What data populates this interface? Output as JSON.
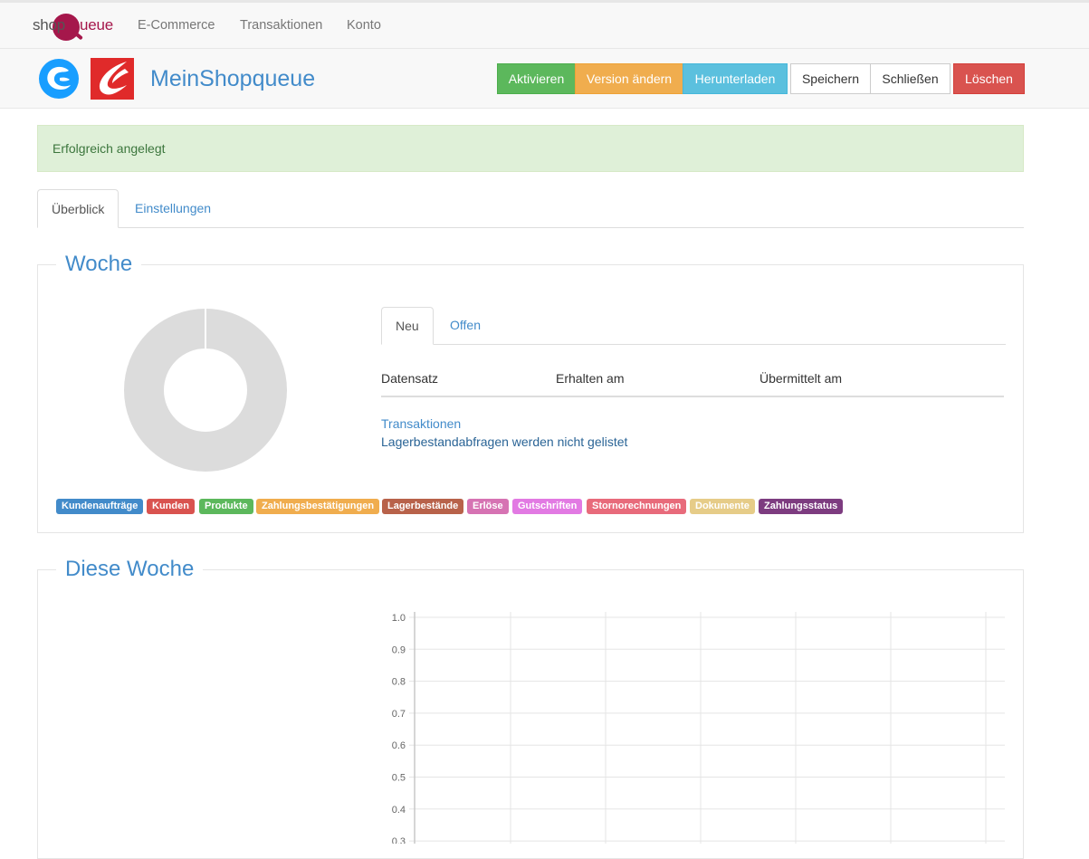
{
  "brand": {
    "prefix": "shop",
    "suffix": "ueue"
  },
  "topnav": {
    "items": [
      "E-Commerce",
      "Transaktionen",
      "Konto"
    ]
  },
  "header": {
    "title": "MeinShopqueue",
    "buttons": {
      "activate": "Aktivieren",
      "change_version": "Version ändern",
      "download": "Herunterladen",
      "save": "Speichern",
      "close": "Schließen",
      "delete": "Löschen"
    }
  },
  "alert": {
    "text": "Erfolgreich angelegt"
  },
  "tabs": {
    "overview": "Überblick",
    "settings": "Einstellungen"
  },
  "week_panel": {
    "title": "Woche",
    "subtabs": {
      "new": "Neu",
      "open": "Offen"
    },
    "table_headers": [
      "Datensatz",
      "Erhalten am",
      "Übermittelt am"
    ],
    "link_transactions": "Transaktionen",
    "note": "Lagerbestandabfragen werden nicht gelistet",
    "legend": [
      {
        "label": "Kundenaufträge",
        "color": "#428bca"
      },
      {
        "label": "Kunden",
        "color": "#d9534f"
      },
      {
        "label": "Produkte",
        "color": "#5cb85c"
      },
      {
        "label": "Zahlungsbestätigungen",
        "color": "#f0ad4e"
      },
      {
        "label": "Lagerbestände",
        "color": "#b8624a"
      },
      {
        "label": "Erlöse",
        "color": "#d673b3"
      },
      {
        "label": "Gutschriften",
        "color": "#e27ae3"
      },
      {
        "label": "Stornorechnungen",
        "color": "#e86b7b"
      },
      {
        "label": "Dokumente",
        "color": "#e6cc88"
      },
      {
        "label": "Zahlungsstatus",
        "color": "#7d3c80"
      }
    ]
  },
  "this_week_panel": {
    "title": "Diese Woche"
  },
  "chart_data": {
    "type": "line",
    "title": "",
    "xlabel": "",
    "ylabel": "",
    "y_ticks_visible": [
      "1.0",
      "0.9",
      "0.8",
      "0.7",
      "0.6",
      "0.5",
      "0.4",
      "0.3"
    ],
    "ylim": [
      0,
      1.0
    ],
    "grid": true,
    "series": []
  }
}
